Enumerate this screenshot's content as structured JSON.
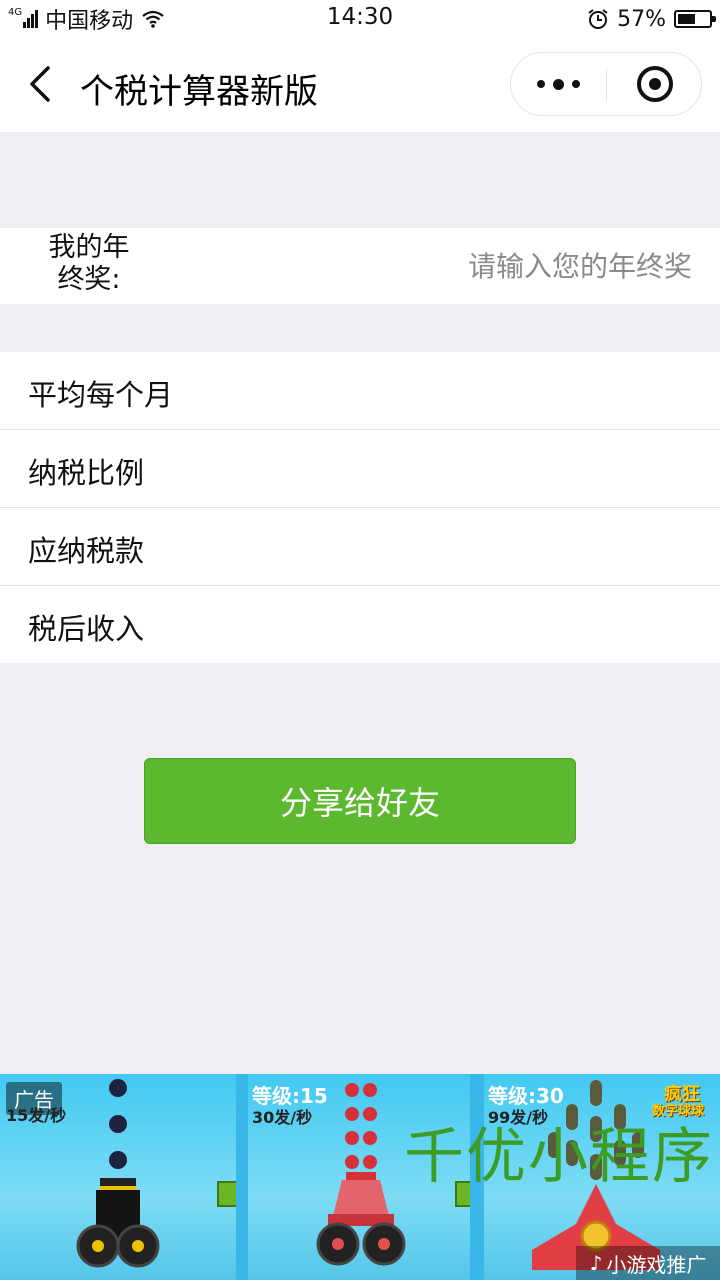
{
  "status_bar": {
    "network": "4G",
    "carrier": "中国移动",
    "time": "14:30",
    "battery_text": "57%",
    "battery_level": 0.57
  },
  "nav": {
    "title": "个税计算器新版",
    "back_icon": "chevron-left-icon",
    "more_icon": "more-dots-icon",
    "close_icon": "target-icon"
  },
  "form": {
    "label": "我的年终奖:",
    "label_line1": "我的年",
    "label_line2": "终奖:",
    "placeholder": "请输入您的年终奖",
    "value": ""
  },
  "results": [
    {
      "label": "平均每个月",
      "value": ""
    },
    {
      "label": "纳税比例",
      "value": ""
    },
    {
      "label": "应纳税款",
      "value": ""
    },
    {
      "label": "税后收入",
      "value": ""
    }
  ],
  "share_button": {
    "label": "分享给好友",
    "color": "#5cb82e"
  },
  "ad": {
    "tag": "广告",
    "panels": [
      {
        "level": "",
        "rate": "15发/秒"
      },
      {
        "level": "等级:15",
        "rate": "30发/秒"
      },
      {
        "level": "等级:30",
        "rate": "99发/秒"
      }
    ],
    "logo_line1": "疯狂",
    "logo_line2": "数字球球",
    "watermark": "千优小程序",
    "footer": "小游戏推广"
  }
}
